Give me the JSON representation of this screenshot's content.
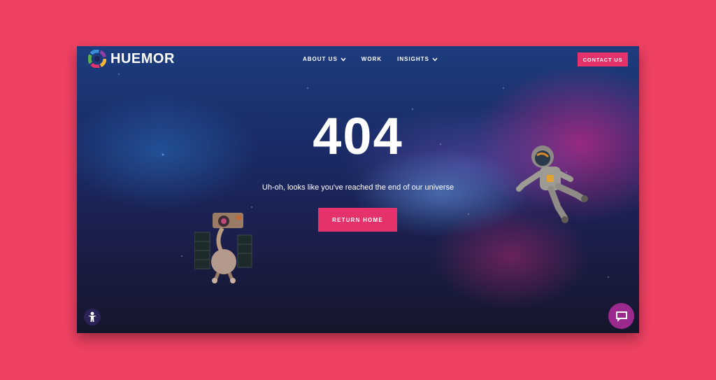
{
  "brand": {
    "name": "HUEMOR",
    "logo_icon": "huemor-logo-icon"
  },
  "nav": {
    "items": [
      {
        "label": "ABOUT US",
        "has_dropdown": true
      },
      {
        "label": "WORK",
        "has_dropdown": false
      },
      {
        "label": "INSIGHTS",
        "has_dropdown": true
      }
    ],
    "contact_label": "CONTACT US"
  },
  "error": {
    "code": "404",
    "message": "Uh-oh, looks like you've reached the end of our universe",
    "button_label": "RETURN HOME"
  },
  "widgets": {
    "accessibility_icon": "accessibility-icon",
    "chat_icon": "chat-icon"
  },
  "colors": {
    "page_background": "#ef4163",
    "accent": "#e6326a",
    "chat_bubble": "#9c2a8e"
  }
}
